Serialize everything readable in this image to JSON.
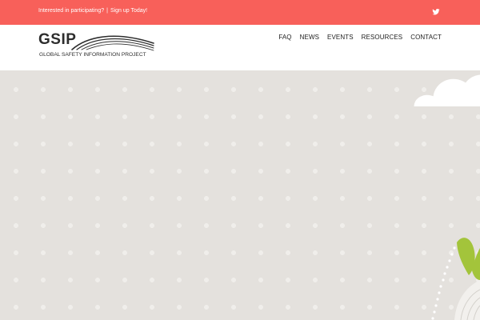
{
  "topbar": {
    "promo_question": "Interested in participating?",
    "promo_separator": "|",
    "promo_link": "Sign up Today!",
    "social_icon": "twitter-icon",
    "color": "#f8605a"
  },
  "logo": {
    "mark": "GSIP",
    "subtitle": "GLOBAL SAFETY INFORMATION PROJECT"
  },
  "nav": {
    "items": [
      "FAQ",
      "NEWS",
      "EVENTS",
      "RESOURCES",
      "CONTACT"
    ]
  },
  "hero": {
    "background": "#e4e1dd",
    "accent_green": "#a3c43b"
  }
}
